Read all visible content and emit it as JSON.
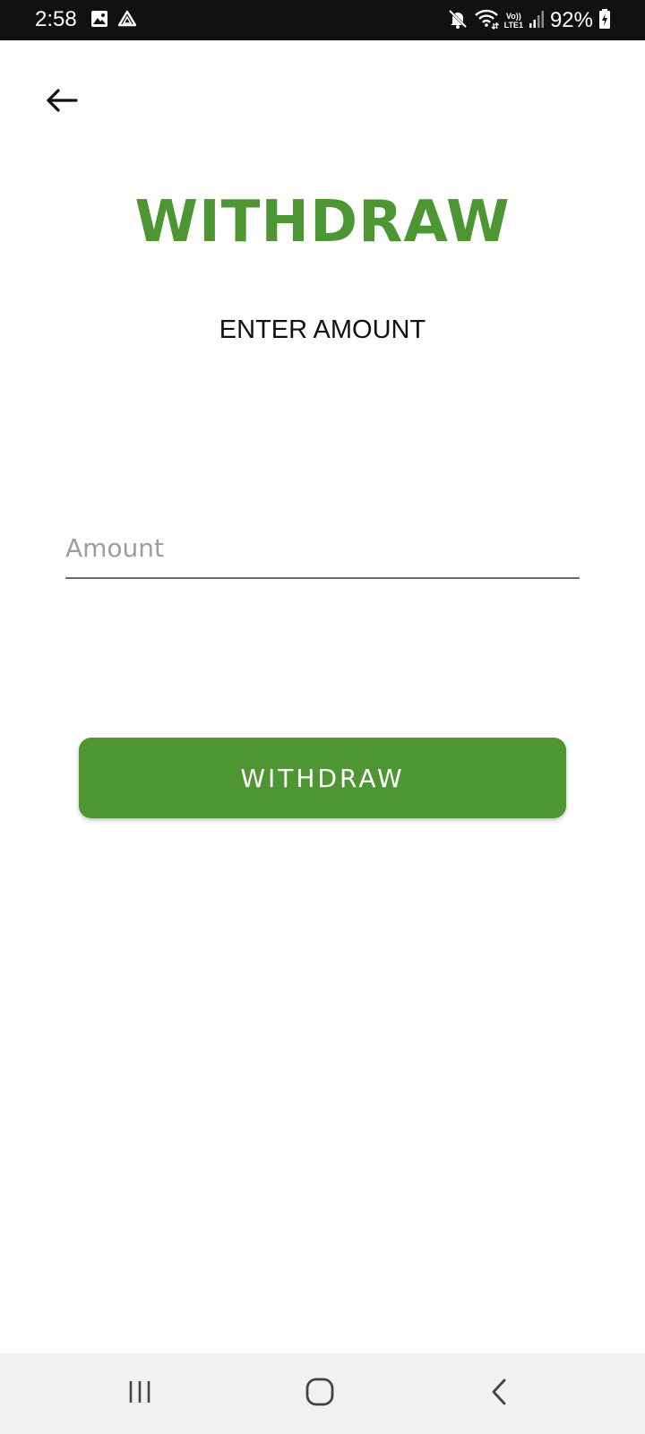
{
  "status_bar": {
    "time": "2:58",
    "battery": "92%",
    "network_top": "Vo))",
    "network_bottom": "LTE1",
    "icons": [
      "gallery-icon",
      "drive-icon",
      "mute-icon",
      "wifi-icon",
      "signal-icon",
      "battery-charging-icon"
    ]
  },
  "header": {
    "back_icon": "arrow-left-icon"
  },
  "main": {
    "title": "WITHDRAW",
    "subtitle": "ENTER AMOUNT",
    "amount_input": {
      "placeholder": "Amount",
      "value": ""
    },
    "withdraw_button_label": "WITHDRAW"
  },
  "nav_bar": {
    "icons": [
      "recent-apps-icon",
      "home-icon",
      "back-icon"
    ]
  },
  "colors": {
    "accent": "#4e9533",
    "status_bar_bg": "#111111",
    "nav_bar_bg": "#f1f1f1",
    "placeholder": "#9e9e9e"
  }
}
